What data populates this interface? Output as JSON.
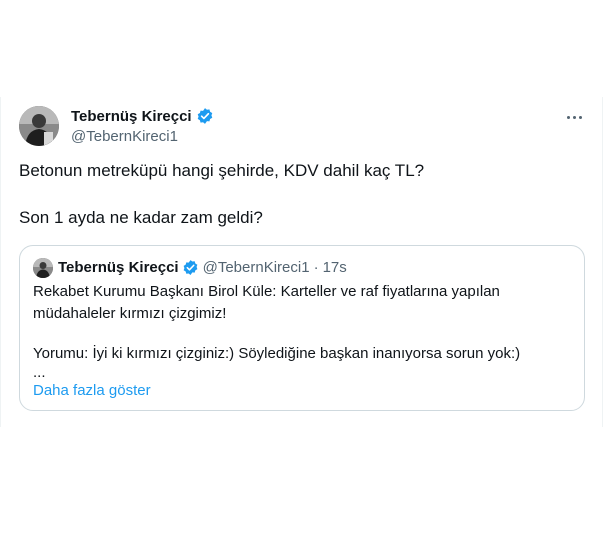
{
  "tweet": {
    "author_name": "Tebernüş Kireçci",
    "author_handle": "@TebernKireci1",
    "text_line1": "Betonun metreküpü hangi şehirde, KDV dahil kaç TL?",
    "text_line2": "Son 1 ayda ne kadar zam geldi?",
    "more_icon": "more-horizontal-icon",
    "verified_icon": "verified-badge-icon"
  },
  "quote": {
    "author_name": "Tebernüş Kireçci",
    "author_handle": "@TebernKireci1",
    "separator": "·",
    "time": "17s",
    "line1": "Rekabet Kurumu Başkanı Birol Küle: Karteller ve raf fiyatlarına yapılan",
    "line2": "müdahaleler kırmızı çizgimiz!",
    "line3": "Yorumu: İyi ki kırmızı çizginiz:) Söylediğine başkan inanıyorsa sorun yok:)",
    "ellipsis": "...",
    "show_more": "Daha fazla göster"
  },
  "colors": {
    "text": "#0f1419",
    "secondary": "#536471",
    "link": "#1d9bf0",
    "verified": "#1d9bf0",
    "border": "#cfd9de"
  }
}
